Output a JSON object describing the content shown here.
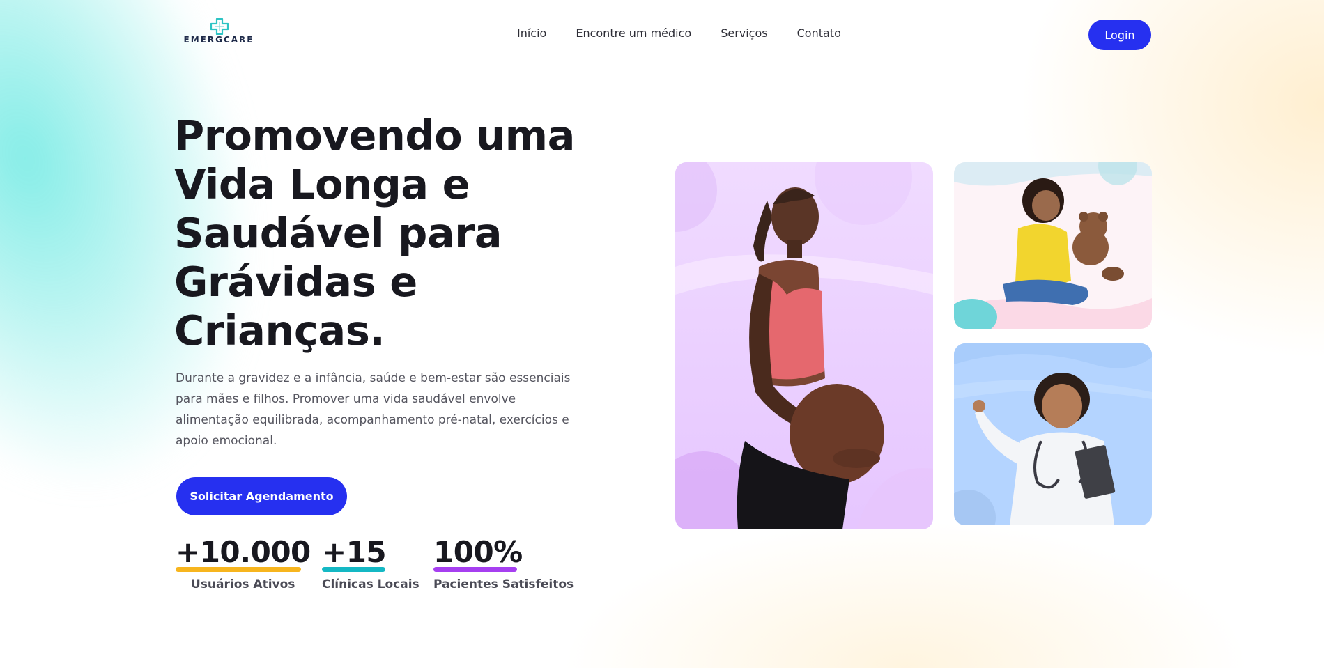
{
  "brand": {
    "name": "EMERGCARE",
    "logo_icon": "medical-cross-icon",
    "accent": "#2630f0",
    "logo_color": "#2ec4c4"
  },
  "nav": {
    "items": [
      {
        "label": "Início"
      },
      {
        "label": "Encontre um médico"
      },
      {
        "label": "Serviços"
      },
      {
        "label": "Contato"
      }
    ],
    "login_label": "Login"
  },
  "hero": {
    "title": "Promovendo uma Vida Longa e Saudável para Grávidas e Crianças.",
    "description": "Durante a gravidez e a infância, saúde e bem-estar são essenciais para mães e filhos. Promover uma vida saudável envolve alimentação equilibrada, acompanhamento pré-natal, exercícios e apoio emocional.",
    "cta_label": "Solicitar Agendamento"
  },
  "stats": [
    {
      "value": "+10.000",
      "label": "Usuários Ativos",
      "color": "#f7b51e"
    },
    {
      "value": "+15",
      "label": "Clínicas Locais",
      "color": "#14b8c4"
    },
    {
      "value": "100%",
      "label": "Pacientes Satisfeitos",
      "color": "#a63ff0"
    }
  ],
  "images": [
    {
      "subject": "pregnant-woman-photo",
      "bg": "#eed4ff"
    },
    {
      "subject": "child-with-teddy-bear-photo",
      "bg": "#fdeef5"
    },
    {
      "subject": "child-doctor-costume-photo",
      "bg": "#b4d4ff"
    }
  ]
}
